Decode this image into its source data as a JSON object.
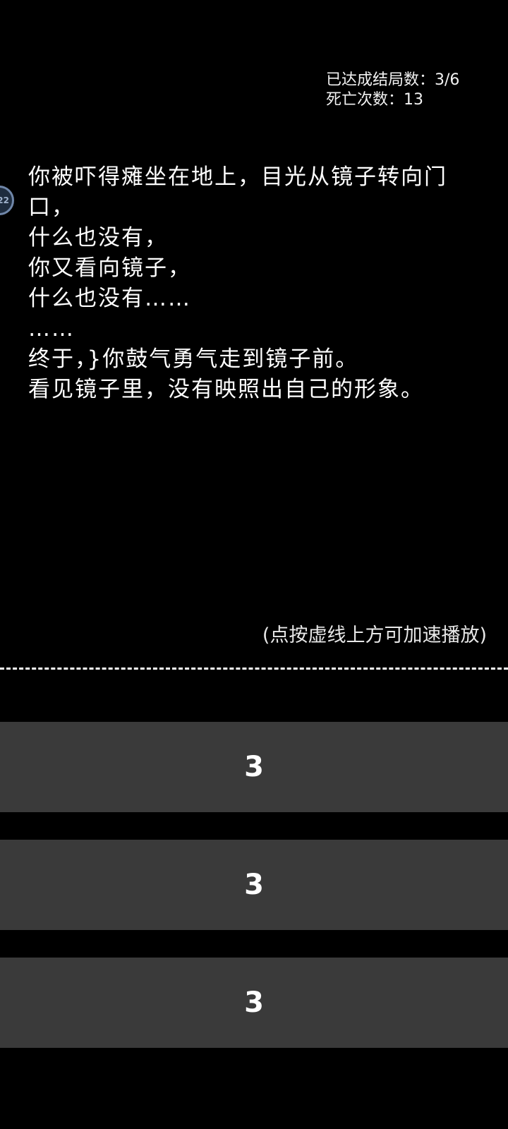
{
  "stats": {
    "endings": "已达成结局数：3/6",
    "deaths": "死亡次数：13"
  },
  "side_badge": {
    "label": "22"
  },
  "story": {
    "lines": [
      "你被吓得瘫坐在地上，目光从镜子转向门口，",
      "什么也没有，",
      "你又看向镜子，",
      "什么也没有……",
      "……",
      "终于，}你鼓气勇气走到镜子前。",
      "看见镜子里，没有映照出自己的形象。"
    ]
  },
  "hint": "(点按虚线上方可加速播放)",
  "choices": [
    {
      "label": "3"
    },
    {
      "label": "3"
    },
    {
      "label": "3"
    }
  ],
  "colors": {
    "background": "#000000",
    "choice_bg": "#3a3a3a",
    "text": "#ffffff"
  }
}
